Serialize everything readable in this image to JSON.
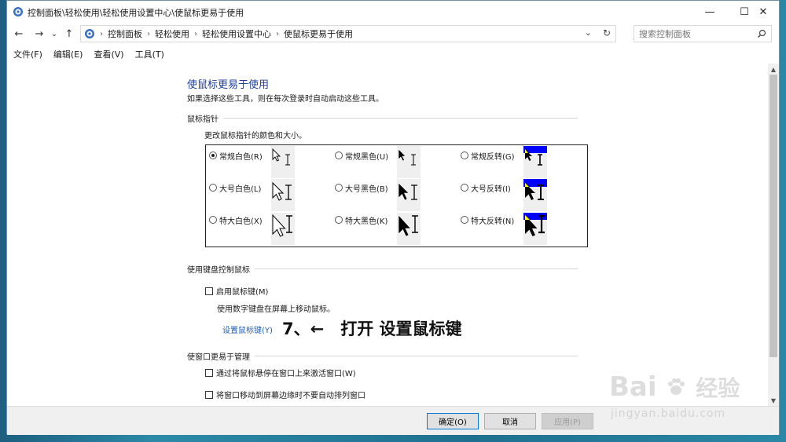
{
  "window": {
    "title": "控制面板\\轻松使用\\轻松使用设置中心\\使鼠标更易于使用",
    "controls": {
      "minimize": "—",
      "maximize": "☐",
      "close": "✕"
    }
  },
  "nav": {
    "back": "←",
    "forward": "→",
    "dropdown": "⌄",
    "up": "↑",
    "refresh": "↻",
    "address_dropdown": "⌄"
  },
  "address": {
    "crumbs": [
      "控制面板",
      "轻松使用",
      "轻松使用设置中心",
      "使鼠标更易于使用"
    ]
  },
  "search": {
    "placeholder": "搜索控制面板"
  },
  "menu": [
    "文件(F)",
    "编辑(E)",
    "查看(V)",
    "工具(T)"
  ],
  "page": {
    "title": "使鼠标更易于使用",
    "description": "如果选择这些工具，则在每次登录时自动启动这些工具。"
  },
  "pointers": {
    "section_title": "鼠标指针",
    "description": "更改鼠标指针的颜色和大小。",
    "options": [
      {
        "label": "常规白色(R)",
        "checked": true
      },
      {
        "label": "常规黑色(U)",
        "checked": false
      },
      {
        "label": "常规反转(G)",
        "checked": false
      },
      {
        "label": "大号白色(L)",
        "checked": false
      },
      {
        "label": "大号黑色(B)",
        "checked": false
      },
      {
        "label": "大号反转(I)",
        "checked": false
      },
      {
        "label": "特大白色(X)",
        "checked": false
      },
      {
        "label": "特大黑色(K)",
        "checked": false
      },
      {
        "label": "特大反转(N)",
        "checked": false
      }
    ]
  },
  "keyboard": {
    "section_title": "使用键盘控制鼠标",
    "checkbox_label": "启用鼠标键(M)",
    "description": "使用数字键盘在屏幕上移动鼠标。",
    "link": "设置鼠标键(Y)"
  },
  "annotation": "7、←　打开 设置鼠标键",
  "window_mgmt": {
    "section_title": "使窗口更易于管理",
    "options": [
      "通过将鼠标悬停在窗口上来激活窗口(W)",
      "将窗口移动到屏幕边缘时不要自动排列窗口"
    ]
  },
  "footer": {
    "ok": "确定(O)",
    "cancel": "取消",
    "apply": "应用(P)"
  },
  "watermark": {
    "brand": "Bai",
    "brand_cn": "经验",
    "url": "jingyan.baidu.com"
  },
  "colors": {
    "title_blue": "#1e3f9a",
    "link_blue": "#1f5fb5",
    "invert_blue": "#0000ff",
    "invert_yellow": "#ffff00"
  }
}
